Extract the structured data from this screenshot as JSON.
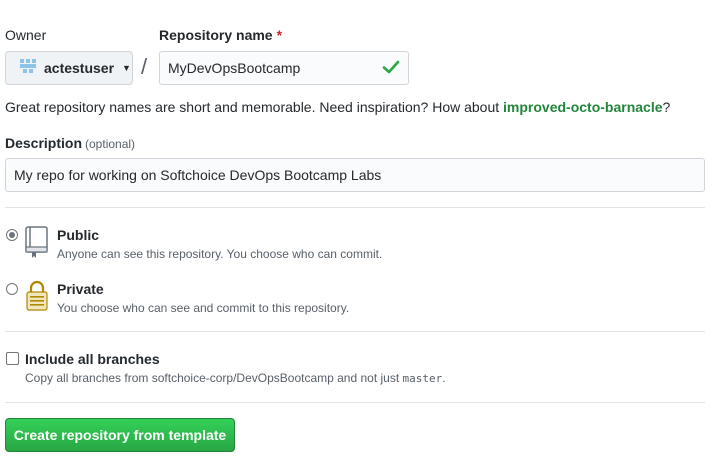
{
  "owner": {
    "label": "Owner",
    "selected": "actestuser"
  },
  "repository": {
    "label": "Repository name",
    "required_mark": "*",
    "value": "MyDevOpsBootcamp"
  },
  "separator": "/",
  "hint": {
    "text": "Great repository names are short and memorable. Need inspiration? How about ",
    "suggestion": "improved-octo-barnacle",
    "end": "?"
  },
  "description": {
    "label": "Description",
    "optional": "(optional)",
    "value": "My repo for working on Softchoice DevOps Bootcamp Labs"
  },
  "visibility": {
    "public": {
      "title": "Public",
      "description": "Anyone can see this repository. You choose who can commit.",
      "checked": true
    },
    "private": {
      "title": "Private",
      "description": "You choose who can see and commit to this repository.",
      "checked": false
    }
  },
  "branches": {
    "title": "Include all branches",
    "description_prefix": "Copy all branches from softchoice-corp/DevOpsBootcamp and not just ",
    "branch": "master",
    "description_suffix": "."
  },
  "actions": {
    "create_label": "Create repository from template"
  },
  "colors": {
    "accent_green": "#28a745",
    "suggestion_green": "#22863a",
    "required_red": "#cb2431"
  },
  "icons": {
    "owner_avatar": "identicon-avatar",
    "valid": "check-icon",
    "public": "repo-book-icon",
    "private": "lock-icon"
  }
}
